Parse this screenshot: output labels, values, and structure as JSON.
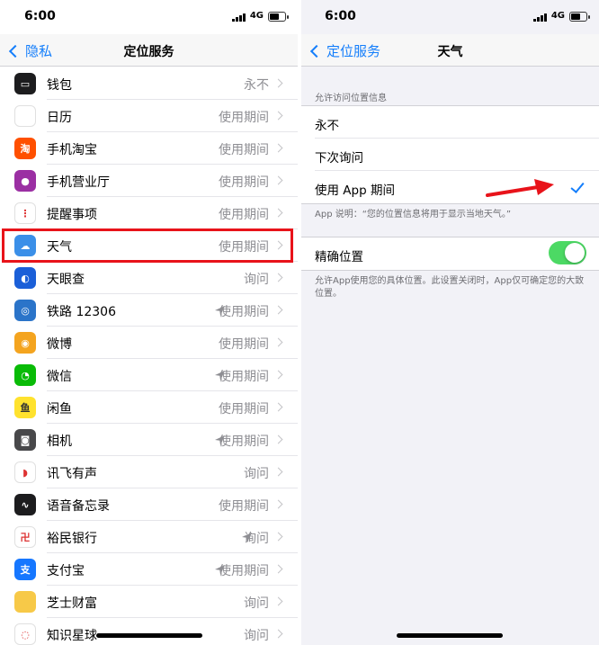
{
  "left": {
    "status": {
      "time": "6:00",
      "network": "4G"
    },
    "nav": {
      "back_label": "隐私",
      "title": "定位服务"
    },
    "apps": [
      {
        "name": "钱包",
        "value": "永不",
        "icon": "wallet-icon",
        "icon_bg": "#1c1c1e",
        "glyph": "▭",
        "location_arrow": false
      },
      {
        "name": "日历",
        "value": "使用期间",
        "icon": "calendar-icon",
        "icon_bg": "#ffffff",
        "glyph": "",
        "location_arrow": false
      },
      {
        "name": "手机淘宝",
        "value": "使用期间",
        "icon": "taobao-icon",
        "icon_bg": "#ff5000",
        "glyph": "淘",
        "location_arrow": false
      },
      {
        "name": "手机营业厅",
        "value": "使用期间",
        "icon": "mobile-hall-icon",
        "icon_bg": "#9b2fa3",
        "glyph": "●",
        "location_arrow": false
      },
      {
        "name": "提醒事项",
        "value": "使用期间",
        "icon": "reminders-icon",
        "icon_bg": "#ffffff",
        "glyph": "⋮",
        "location_arrow": false
      },
      {
        "name": "天气",
        "value": "使用期间",
        "icon": "weather-icon",
        "icon_bg": "#3b8fe8",
        "glyph": "☁",
        "location_arrow": false
      },
      {
        "name": "天眼查",
        "value": "询问",
        "icon": "tianyancha-icon",
        "icon_bg": "#1b5fd8",
        "glyph": "◐",
        "location_arrow": false
      },
      {
        "name": "铁路 12306",
        "value": "使用期间",
        "icon": "railway-icon",
        "icon_bg": "#2b74c9",
        "glyph": "◎",
        "location_arrow": true
      },
      {
        "name": "微博",
        "value": "使用期间",
        "icon": "weibo-icon",
        "icon_bg": "#f4a41f",
        "glyph": "◉",
        "location_arrow": false
      },
      {
        "name": "微信",
        "value": "使用期间",
        "icon": "wechat-icon",
        "icon_bg": "#09bb07",
        "glyph": "◔",
        "location_arrow": true
      },
      {
        "name": "闲鱼",
        "value": "使用期间",
        "icon": "xianyu-icon",
        "icon_bg": "#ffe22e",
        "glyph": "鱼",
        "location_arrow": false
      },
      {
        "name": "相机",
        "value": "使用期间",
        "icon": "camera-icon",
        "icon_bg": "#48484a",
        "glyph": "◙",
        "location_arrow": true
      },
      {
        "name": "讯飞有声",
        "value": "询问",
        "icon": "xunfei-icon",
        "icon_bg": "#ffffff",
        "glyph": "◗",
        "location_arrow": false
      },
      {
        "name": "语音备忘录",
        "value": "使用期间",
        "icon": "voice-memo-icon",
        "icon_bg": "#1c1c1e",
        "glyph": "∿",
        "location_arrow": false
      },
      {
        "name": "裕民银行",
        "value": "询问",
        "icon": "bank-icon",
        "icon_bg": "#ffffff",
        "glyph": "卍",
        "location_arrow": true
      },
      {
        "name": "支付宝",
        "value": "使用期间",
        "icon": "alipay-icon",
        "icon_bg": "#1677ff",
        "glyph": "支",
        "location_arrow": true
      },
      {
        "name": "芝士财富",
        "value": "询问",
        "icon": "zhishi-icon",
        "icon_bg": "#f7c948",
        "glyph": "",
        "location_arrow": false
      },
      {
        "name": "知识星球",
        "value": "询问",
        "icon": "zsxq-icon",
        "icon_bg": "#ffffff",
        "glyph": "◌",
        "location_arrow": false
      }
    ]
  },
  "right": {
    "status": {
      "time": "6:00",
      "network": "4G"
    },
    "nav": {
      "back_label": "定位服务",
      "title": "天气"
    },
    "access_header": "允许访问位置信息",
    "options": [
      {
        "label": "永不",
        "selected": false
      },
      {
        "label": "下次询问",
        "selected": false
      },
      {
        "label": "使用 App 期间",
        "selected": true
      }
    ],
    "app_note": "App 说明：“您的位置信息将用于显示当地天气。”",
    "precise": {
      "label": "精确位置",
      "on": true
    },
    "precise_note": "允许App使用您的具体位置。此设置关闭时，App仅可确定您的大致位置。"
  },
  "colors": {
    "accent": "#147efb",
    "toggle_on": "#4cd964",
    "highlight": "#e8131a"
  }
}
